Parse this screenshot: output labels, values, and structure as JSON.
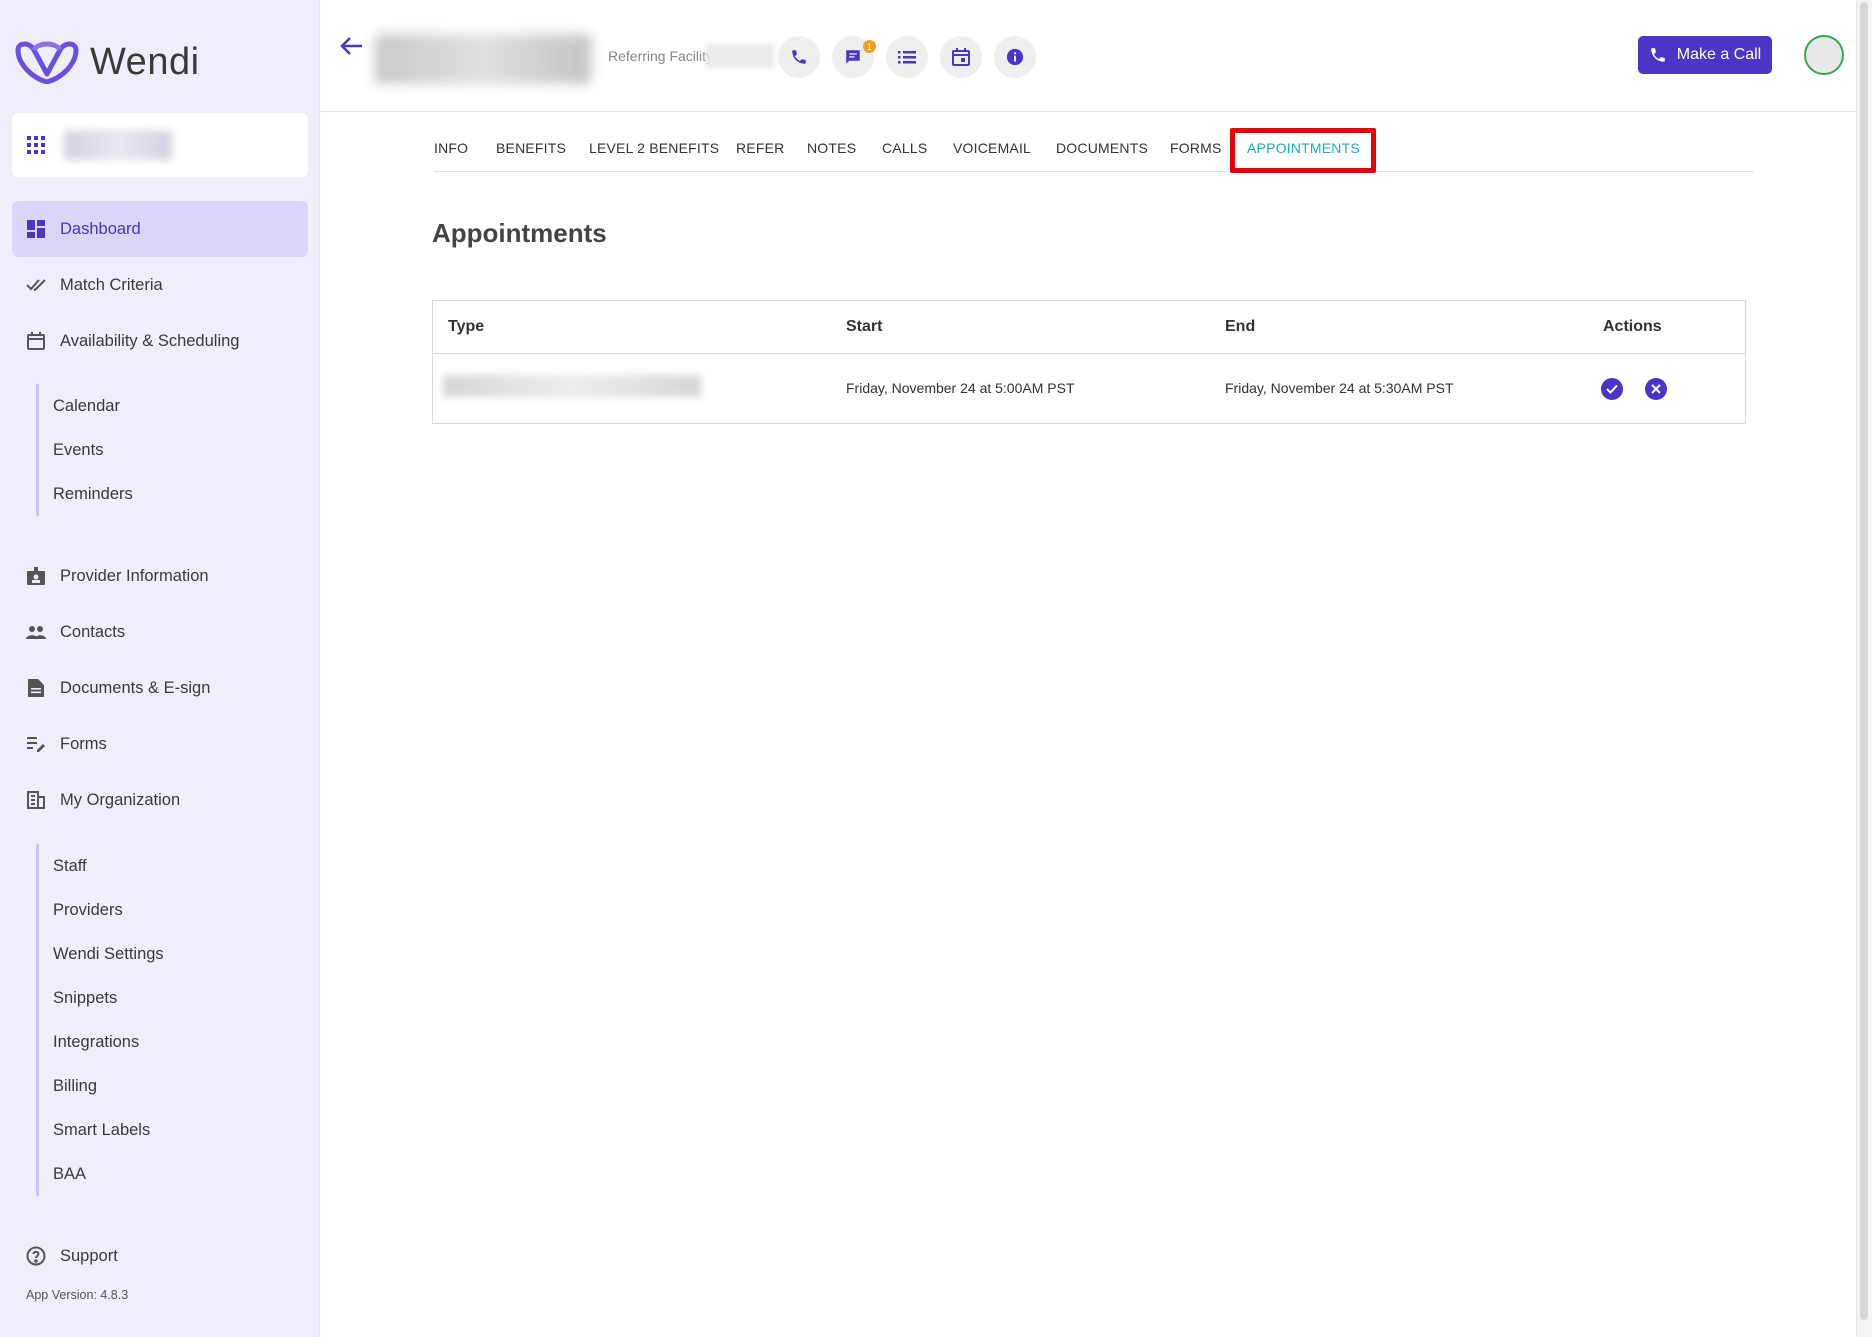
{
  "app": {
    "name": "Wendi",
    "version": "App Version: 4.8.3"
  },
  "sidebar": {
    "items": [
      {
        "label": "Dashboard",
        "icon": "dashboard-icon"
      },
      {
        "label": "Match Criteria",
        "icon": "double-check-icon"
      },
      {
        "label": "Availability & Scheduling",
        "icon": "calendar-icon"
      }
    ],
    "scheduling_sub": [
      "Calendar",
      "Events",
      "Reminders"
    ],
    "items2": [
      {
        "label": "Provider Information",
        "icon": "id-badge-icon"
      },
      {
        "label": "Contacts",
        "icon": "people-icon"
      },
      {
        "label": "Documents & E-sign",
        "icon": "document-icon"
      },
      {
        "label": "Forms",
        "icon": "form-edit-icon"
      },
      {
        "label": "My Organization",
        "icon": "building-icon"
      }
    ],
    "org_sub": [
      "Staff",
      "Providers",
      "Wendi Settings",
      "Snippets",
      "Integrations",
      "Billing",
      "Smart Labels",
      "BAA"
    ],
    "support": "Support"
  },
  "header": {
    "referring_label": "Referring Facility",
    "chat_badge": "1",
    "make_call": "Make a Call"
  },
  "tabs": [
    "INFO",
    "BENEFITS",
    "LEVEL 2 BENEFITS",
    "REFER",
    "NOTES",
    "CALLS",
    "VOICEMAIL",
    "DOCUMENTS",
    "FORMS",
    "APPOINTMENTS"
  ],
  "active_tab": "APPOINTMENTS",
  "main": {
    "title": "Appointments",
    "columns": [
      "Type",
      "Start",
      "End",
      "Actions"
    ],
    "rows": [
      {
        "start": "Friday, November 24 at 5:00AM PST",
        "end": "Friday, November 24 at 5:30AM PST"
      }
    ]
  },
  "colors": {
    "brand": "#4b34c6",
    "active_tab": "#16b0b4",
    "highlight": "#e8000b"
  }
}
